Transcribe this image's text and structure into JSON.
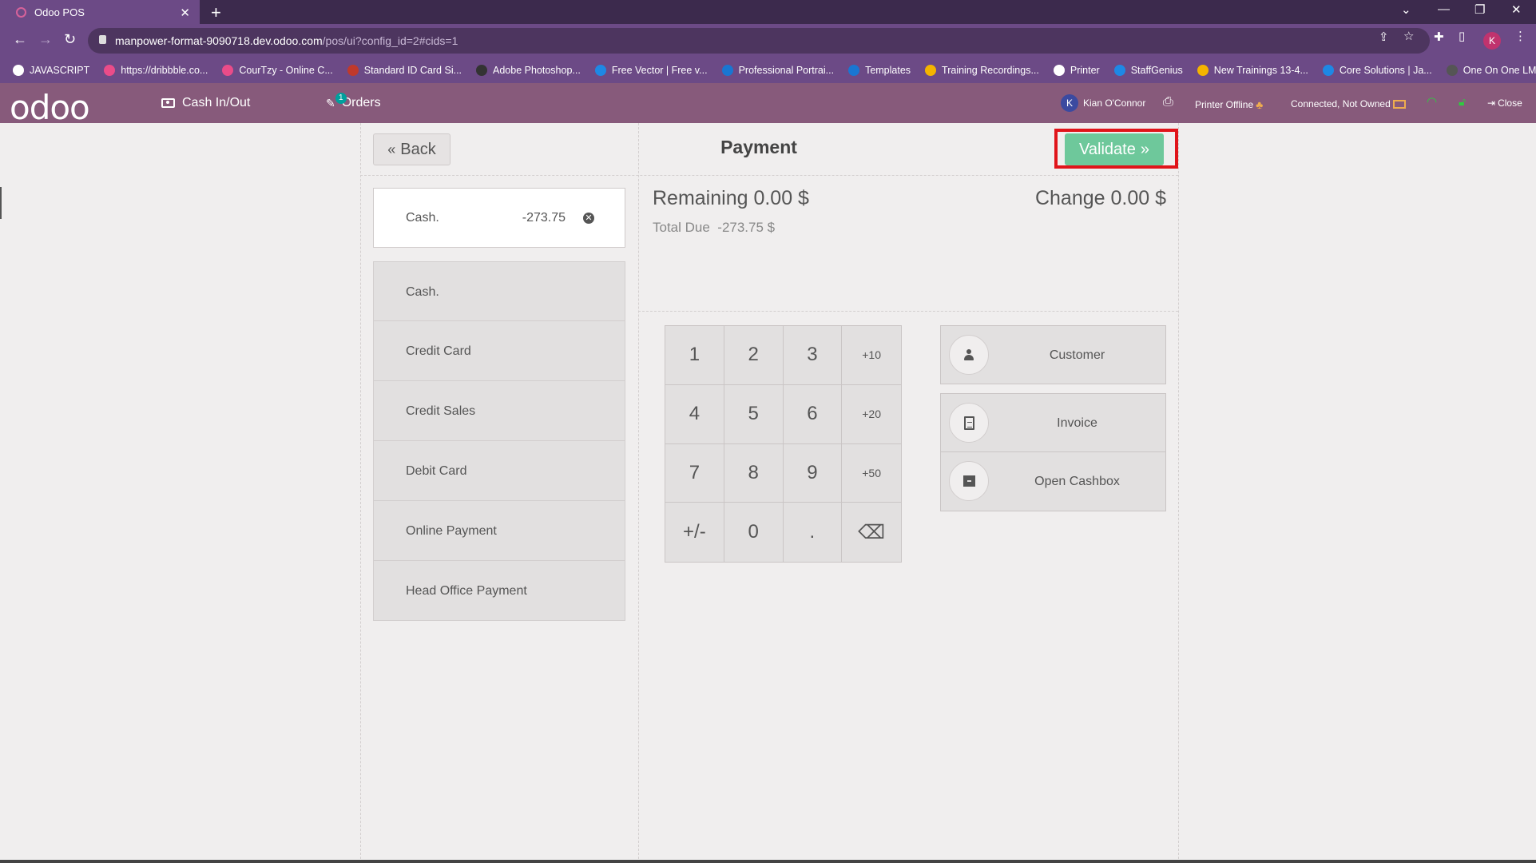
{
  "browser": {
    "tab_title": "Odoo POS",
    "url_host": "manpower-format-9090718.dev.odoo.com",
    "url_path": "/pos/ui?config_id=2#cids=1",
    "profile_initial": "K",
    "bookmarks": [
      {
        "label": "JAVASCRIPT",
        "color": "#ffffff"
      },
      {
        "label": "https://dribbble.co...",
        "color": "#ea4c89"
      },
      {
        "label": "CourTzy - Online C...",
        "color": "#ea4c89"
      },
      {
        "label": "Standard ID Card Si...",
        "color": "#c0392b"
      },
      {
        "label": "Adobe Photoshop...",
        "color": "#333333"
      },
      {
        "label": "Free Vector | Free v...",
        "color": "#1e88e5"
      },
      {
        "label": "Professional Portrai...",
        "color": "#1976d2"
      },
      {
        "label": "Templates",
        "color": "#1976d2"
      },
      {
        "label": "Training Recordings...",
        "color": "#f4b400"
      },
      {
        "label": "Printer",
        "color": "#ffffff"
      },
      {
        "label": "StaffGenius",
        "color": "#1e88e5"
      },
      {
        "label": "New Trainings 13-4...",
        "color": "#f4b400"
      },
      {
        "label": "Core Solutions | Ja...",
        "color": "#1e88e5"
      },
      {
        "label": "One On One LMS O...",
        "color": "#555555"
      }
    ]
  },
  "pos_header": {
    "logo": "odoo",
    "cash_in_out": "Cash In/Out",
    "orders": "Orders",
    "orders_badge": "1",
    "user_initial": "K",
    "user_name": "Kian O'Connor",
    "printer_status": "Printer Offline",
    "connection_status": "Connected, Not Owned",
    "close": "Close"
  },
  "payment": {
    "back": "Back",
    "title": "Payment",
    "validate": "Validate",
    "selected_line": {
      "method": "Cash.",
      "amount": "-273.75"
    },
    "methods": [
      "Cash.",
      "Credit Card",
      "Credit Sales",
      "Debit Card",
      "Online Payment",
      "Head Office Payment"
    ],
    "remaining": "Remaining 0.00 $",
    "change": "Change 0.00 $",
    "total_due_label": "Total Due",
    "total_due_value": "-273.75 $",
    "numpad": [
      "1",
      "2",
      "3",
      "+10",
      "4",
      "5",
      "6",
      "+20",
      "7",
      "8",
      "9",
      "+50",
      "+/-",
      "0",
      ".",
      "⌫"
    ],
    "actions": [
      {
        "label": "Customer",
        "icon": "person-icon"
      },
      {
        "label": "Invoice",
        "icon": "document-icon"
      },
      {
        "label": "Open Cashbox",
        "icon": "archive-icon"
      }
    ]
  },
  "colors": {
    "header": "#875a7b",
    "validate": "#6ec89b",
    "highlight": "#e0141a"
  }
}
